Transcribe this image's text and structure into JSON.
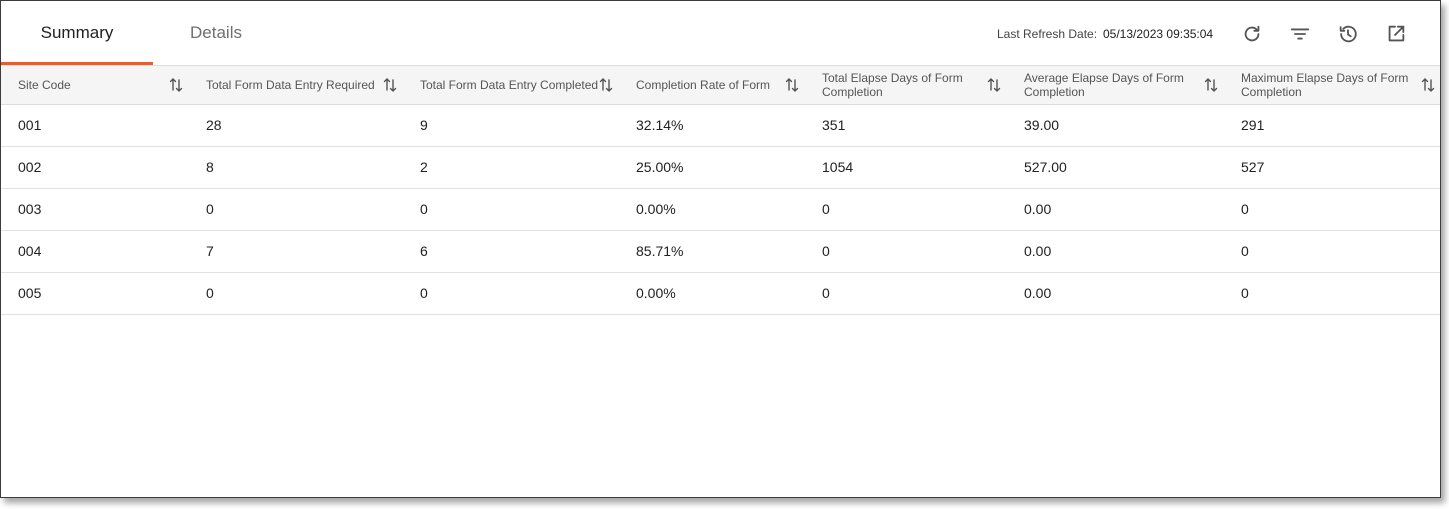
{
  "tabs": {
    "summary": "Summary",
    "details": "Details"
  },
  "refresh": {
    "label": "Last Refresh Date:",
    "value": "05/13/2023 09:35:04"
  },
  "toolbar": {
    "icons": [
      "refresh-icon",
      "filter-icon",
      "history-icon",
      "open-external-icon"
    ]
  },
  "table": {
    "headers": [
      "Site Code",
      "Total Form Data Entry Required",
      "Total Form Data Entry Completed",
      "Completion Rate of Form",
      "Total Elapse Days of Form Completion",
      "Average Elapse Days of Form Completion",
      "Maximum Elapse Days of Form Completion"
    ],
    "rows": [
      [
        "001",
        "28",
        "9",
        "32.14%",
        "351",
        "39.00",
        "291"
      ],
      [
        "002",
        "8",
        "2",
        "25.00%",
        "1054",
        "527.00",
        "527"
      ],
      [
        "003",
        "0",
        "0",
        "0.00%",
        "0",
        "0.00",
        "0"
      ],
      [
        "004",
        "7",
        "6",
        "85.71%",
        "0",
        "0.00",
        "0"
      ],
      [
        "005",
        "0",
        "0",
        "0.00%",
        "0",
        "0.00",
        "0"
      ]
    ]
  }
}
